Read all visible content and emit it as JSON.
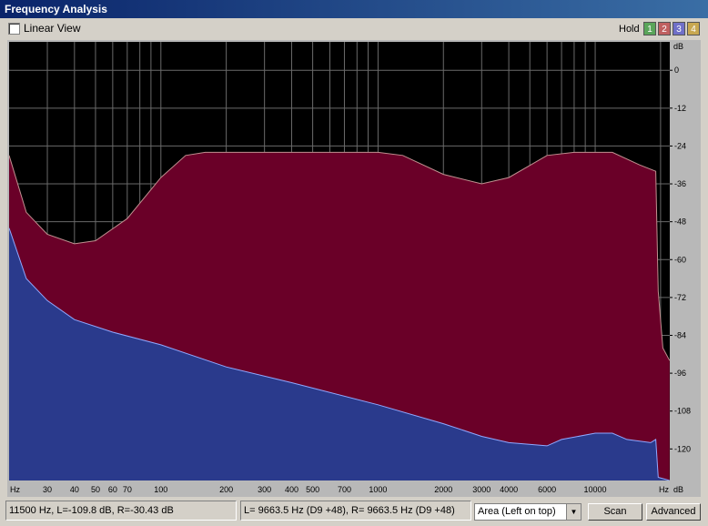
{
  "window": {
    "title": "Frequency Analysis"
  },
  "toolbar": {
    "linear_view_label": "Linear View",
    "linear_view_checked": false,
    "hold_label": "Hold",
    "hold_buttons": [
      {
        "label": "1",
        "color": "#5aa55a"
      },
      {
        "label": "2",
        "color": "#c06060"
      },
      {
        "label": "3",
        "color": "#7070c8"
      },
      {
        "label": "4",
        "color": "#c8a850"
      }
    ]
  },
  "status": {
    "cursor_readout": "11500 Hz, L=-109.8 dB, R=-30.43 dB",
    "peak_readout": "L= 9663.5 Hz (D9 +48), R= 9663.5 Hz (D9 +48)",
    "display_mode": "Area (Left on top)",
    "scan_label": "Scan",
    "advanced_label": "Advanced"
  },
  "chart_data": {
    "type": "area",
    "x_scale": "log",
    "xlim": [
      20,
      22050
    ],
    "ylim": [
      -130,
      9
    ],
    "x_unit_label": "Hz",
    "y_unit_label": "dB",
    "x_ticks": [
      {
        "v": 30,
        "label": "30"
      },
      {
        "v": 40,
        "label": "40"
      },
      {
        "v": 50,
        "label": "50"
      },
      {
        "v": 60,
        "label": "60"
      },
      {
        "v": 70,
        "label": "70"
      },
      {
        "v": 100,
        "label": "100"
      },
      {
        "v": 200,
        "label": "200"
      },
      {
        "v": 300,
        "label": "300"
      },
      {
        "v": 400,
        "label": "400"
      },
      {
        "v": 500,
        "label": "500"
      },
      {
        "v": 700,
        "label": "700"
      },
      {
        "v": 1000,
        "label": "1000"
      },
      {
        "v": 2000,
        "label": "2000"
      },
      {
        "v": 3000,
        "label": "3000"
      },
      {
        "v": 4000,
        "label": "4000"
      },
      {
        "v": 6000,
        "label": "6000"
      },
      {
        "v": 10000,
        "label": "10000"
      }
    ],
    "x_minor": [
      80,
      90,
      600,
      800,
      900,
      5000,
      7000,
      8000,
      9000,
      20000
    ],
    "y_ticks": [
      0,
      -12,
      -24,
      -36,
      -48,
      -60,
      -72,
      -84,
      -96,
      -108,
      -120
    ],
    "colors": {
      "left_fill": "#2a3a8c",
      "left_line": "#8fa8ff",
      "right_fill": "#6a0028",
      "right_line": "#c09090",
      "background": "#000000",
      "grid": "#6a6a6a"
    },
    "series": [
      {
        "side": "right",
        "points": [
          [
            20,
            -27
          ],
          [
            24,
            -45
          ],
          [
            30,
            -52
          ],
          [
            40,
            -55
          ],
          [
            50,
            -54
          ],
          [
            70,
            -47
          ],
          [
            100,
            -34
          ],
          [
            130,
            -27
          ],
          [
            160,
            -26
          ],
          [
            200,
            -26
          ],
          [
            400,
            -26
          ],
          [
            1000,
            -26
          ],
          [
            1300,
            -27
          ],
          [
            2000,
            -33
          ],
          [
            3000,
            -36
          ],
          [
            4000,
            -34
          ],
          [
            6000,
            -27
          ],
          [
            8000,
            -26
          ],
          [
            10000,
            -26
          ],
          [
            12000,
            -26
          ],
          [
            16000,
            -30
          ],
          [
            19000,
            -32
          ],
          [
            19500,
            -70
          ],
          [
            20500,
            -88
          ],
          [
            22000,
            -92
          ]
        ]
      },
      {
        "side": "left",
        "points": [
          [
            20,
            -50
          ],
          [
            24,
            -66
          ],
          [
            30,
            -73
          ],
          [
            40,
            -79
          ],
          [
            60,
            -83
          ],
          [
            100,
            -87
          ],
          [
            200,
            -94
          ],
          [
            400,
            -99
          ],
          [
            1000,
            -106
          ],
          [
            2000,
            -112
          ],
          [
            3000,
            -116
          ],
          [
            4000,
            -118
          ],
          [
            6000,
            -119
          ],
          [
            7000,
            -117
          ],
          [
            10000,
            -115
          ],
          [
            12000,
            -115
          ],
          [
            14000,
            -117
          ],
          [
            18000,
            -118
          ],
          [
            19000,
            -117
          ],
          [
            19500,
            -129
          ],
          [
            22000,
            -130
          ]
        ]
      }
    ]
  }
}
